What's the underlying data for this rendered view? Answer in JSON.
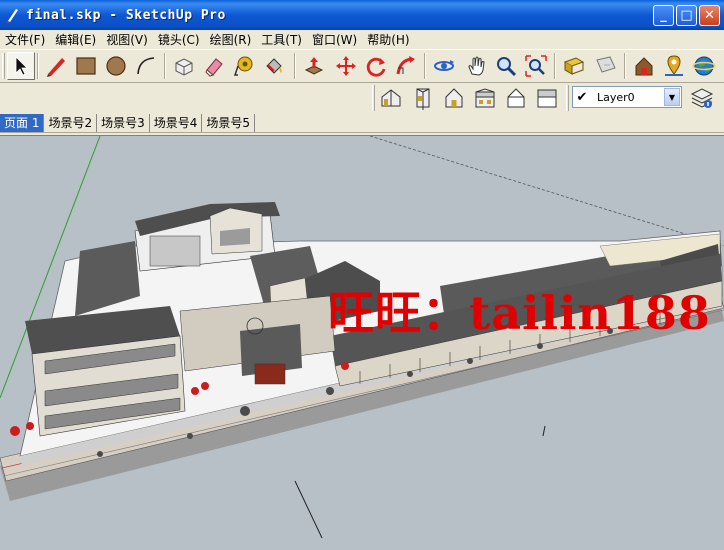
{
  "window": {
    "title": "final.skp - SketchUp Pro",
    "min_glyph": "_",
    "max_glyph": "□",
    "close_glyph": "✕"
  },
  "menu": {
    "items": [
      {
        "label": "文件(F)"
      },
      {
        "label": "编辑(E)"
      },
      {
        "label": "视图(V)"
      },
      {
        "label": "镜头(C)"
      },
      {
        "label": "绘图(R)"
      },
      {
        "label": "工具(T)"
      },
      {
        "label": "窗口(W)"
      },
      {
        "label": "帮助(H)"
      }
    ]
  },
  "toolbar": {
    "layer_check": "✔",
    "layer_name": "Layer0",
    "layer_arrow": "▼"
  },
  "tabs": [
    {
      "label": "页面 1",
      "active": true
    },
    {
      "label": "场景号2"
    },
    {
      "label": "场景号3"
    },
    {
      "label": "场景号4"
    },
    {
      "label": "场景号5"
    }
  ],
  "viewport": {
    "watermark": "旺旺：tailin188"
  },
  "colors": {
    "titlebar": "#0a5fd8",
    "viewport_bg": "#b7bfc7",
    "watermark": "#e00000",
    "active_tab": "#316ac5"
  }
}
